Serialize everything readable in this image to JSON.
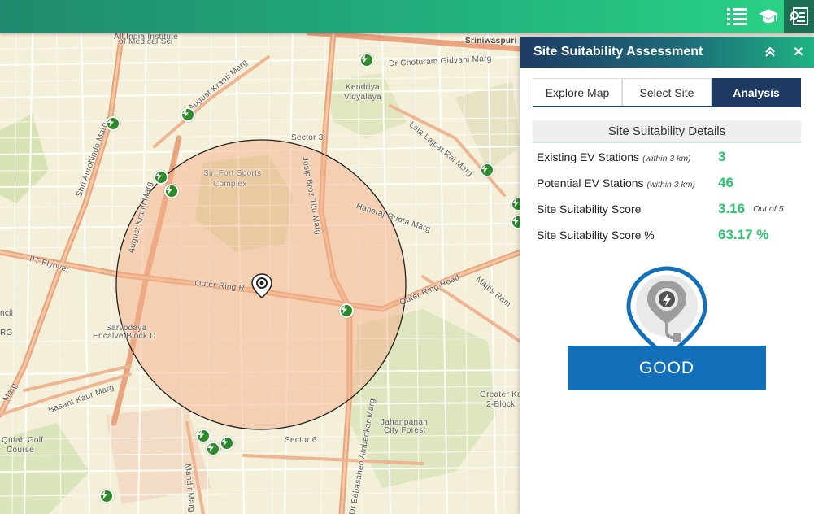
{
  "toolbar": {
    "buttons": [
      {
        "icon": "layer-list-icon",
        "active": false
      },
      {
        "icon": "graduation-cap-icon",
        "active": false
      },
      {
        "icon": "report-icon",
        "active": true
      }
    ]
  },
  "map": {
    "labels": [
      {
        "text": "All India Institute"
      },
      {
        "text": "of Medical Sci"
      },
      {
        "text": "Sriniwaspuri"
      },
      {
        "text": "Dr Choturam Gidvani Marg"
      },
      {
        "text": "Kendriya"
      },
      {
        "text": "Vidyalaya"
      },
      {
        "text": "August Kranti Marg"
      },
      {
        "text": "Shri Aurobindo Marg"
      },
      {
        "text": "Sector 3"
      },
      {
        "text": "Lala Lajpat Rai Marg"
      },
      {
        "text": "Siri Fort Sports"
      },
      {
        "text": "Complex"
      },
      {
        "text": "August Kranti Marg"
      },
      {
        "text": "Josip Broz Tito Marg"
      },
      {
        "text": "Hansraj Gupta Marg"
      },
      {
        "text": "IIT Flyover"
      },
      {
        "text": "Outer Ring R"
      },
      {
        "text": "Outer Ring Road"
      },
      {
        "text": "Majlis Ram"
      },
      {
        "text": "ncil"
      },
      {
        "text": "RG"
      },
      {
        "text": "Sarvodaya"
      },
      {
        "text": "Encalve-Block D"
      },
      {
        "text": "Marg"
      },
      {
        "text": "Basant Kaur Marg"
      },
      {
        "text": "Dr Babasaheb Ambedkar Marg"
      },
      {
        "text": "Greater Ka"
      },
      {
        "text": "2-Block"
      },
      {
        "text": "Jahanpanah"
      },
      {
        "text": "City Forest"
      },
      {
        "text": "Qutab Golf"
      },
      {
        "text": "Course"
      },
      {
        "text": "Sector 6"
      },
      {
        "text": "Mandir Marg"
      }
    ]
  },
  "panel": {
    "title": "Site Suitability Assessment",
    "collapse_icon": "double-chevron-up-icon",
    "close_label": "✕",
    "tabs": [
      {
        "label": "Explore Map",
        "active": false
      },
      {
        "label": "Select Site",
        "active": false
      },
      {
        "label": "Analysis",
        "active": true
      }
    ],
    "details_heading": "Site Suitability Details",
    "rows": [
      {
        "label": "Existing EV Stations",
        "qualifier": "(within 3 km)",
        "value": "3",
        "note": ""
      },
      {
        "label": "Potential EV Stations",
        "qualifier": "(within 3 km)",
        "value": "46",
        "note": ""
      },
      {
        "label": "Site Suitability Score",
        "qualifier": "",
        "value": "3.16",
        "note": "Out of 5"
      },
      {
        "label": "Site Suitability Score %",
        "qualifier": "",
        "value": "63.17 %",
        "note": ""
      }
    ],
    "result_label": "GOOD"
  },
  "colors": {
    "topbar": "#22b07d",
    "panel_header": "#1d3b64",
    "active_tab": "#1f3b63",
    "value_green": "#2bc46e",
    "result_blue": "#1170b9",
    "ev_marker": "#2d8a2a",
    "buffer_fill": "#f4b08a"
  }
}
